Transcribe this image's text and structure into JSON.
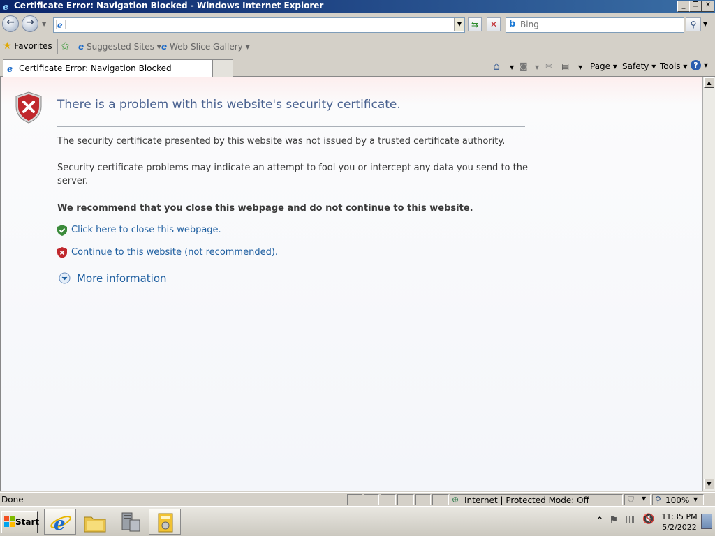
{
  "window": {
    "title": "Certificate Error: Navigation Blocked - Windows Internet Explorer"
  },
  "navbar": {
    "address_value": "",
    "search_placeholder": "Bing"
  },
  "favorites_bar": {
    "favorites_label": "Favorites",
    "items": [
      {
        "label": "Suggested Sites"
      },
      {
        "label": "Web Slice Gallery"
      }
    ]
  },
  "tabs": [
    {
      "label": "Certificate Error: Navigation Blocked"
    }
  ],
  "command_bar": {
    "page_label": "Page",
    "safety_label": "Safety",
    "tools_label": "Tools"
  },
  "content": {
    "heading": "There is a problem with this website's security certificate.",
    "paragraph1": "The security certificate presented by this website was not issued by a trusted certificate authority.",
    "paragraph2_line1": "Security certificate problems may indicate an attempt to fool you or intercept any data you send to the",
    "paragraph2_line2": "server.",
    "recommendation": "We recommend that you close this webpage and do not continue to this website.",
    "close_link": "Click here to close this webpage.",
    "continue_link": "Continue to this website (not recommended).",
    "more_info": "More information"
  },
  "statusbar": {
    "status_text": "Done",
    "zone_text": "Internet | Protected Mode: Off",
    "zoom_text": "100%"
  },
  "taskbar": {
    "start_label": "Start",
    "time": "11:35 PM",
    "date": "5/2/2022"
  },
  "colors": {
    "heading": "#4a6290",
    "link": "#1f5fa0",
    "shield_red": "#c0282d",
    "shield_green": "#3a8a3a"
  }
}
